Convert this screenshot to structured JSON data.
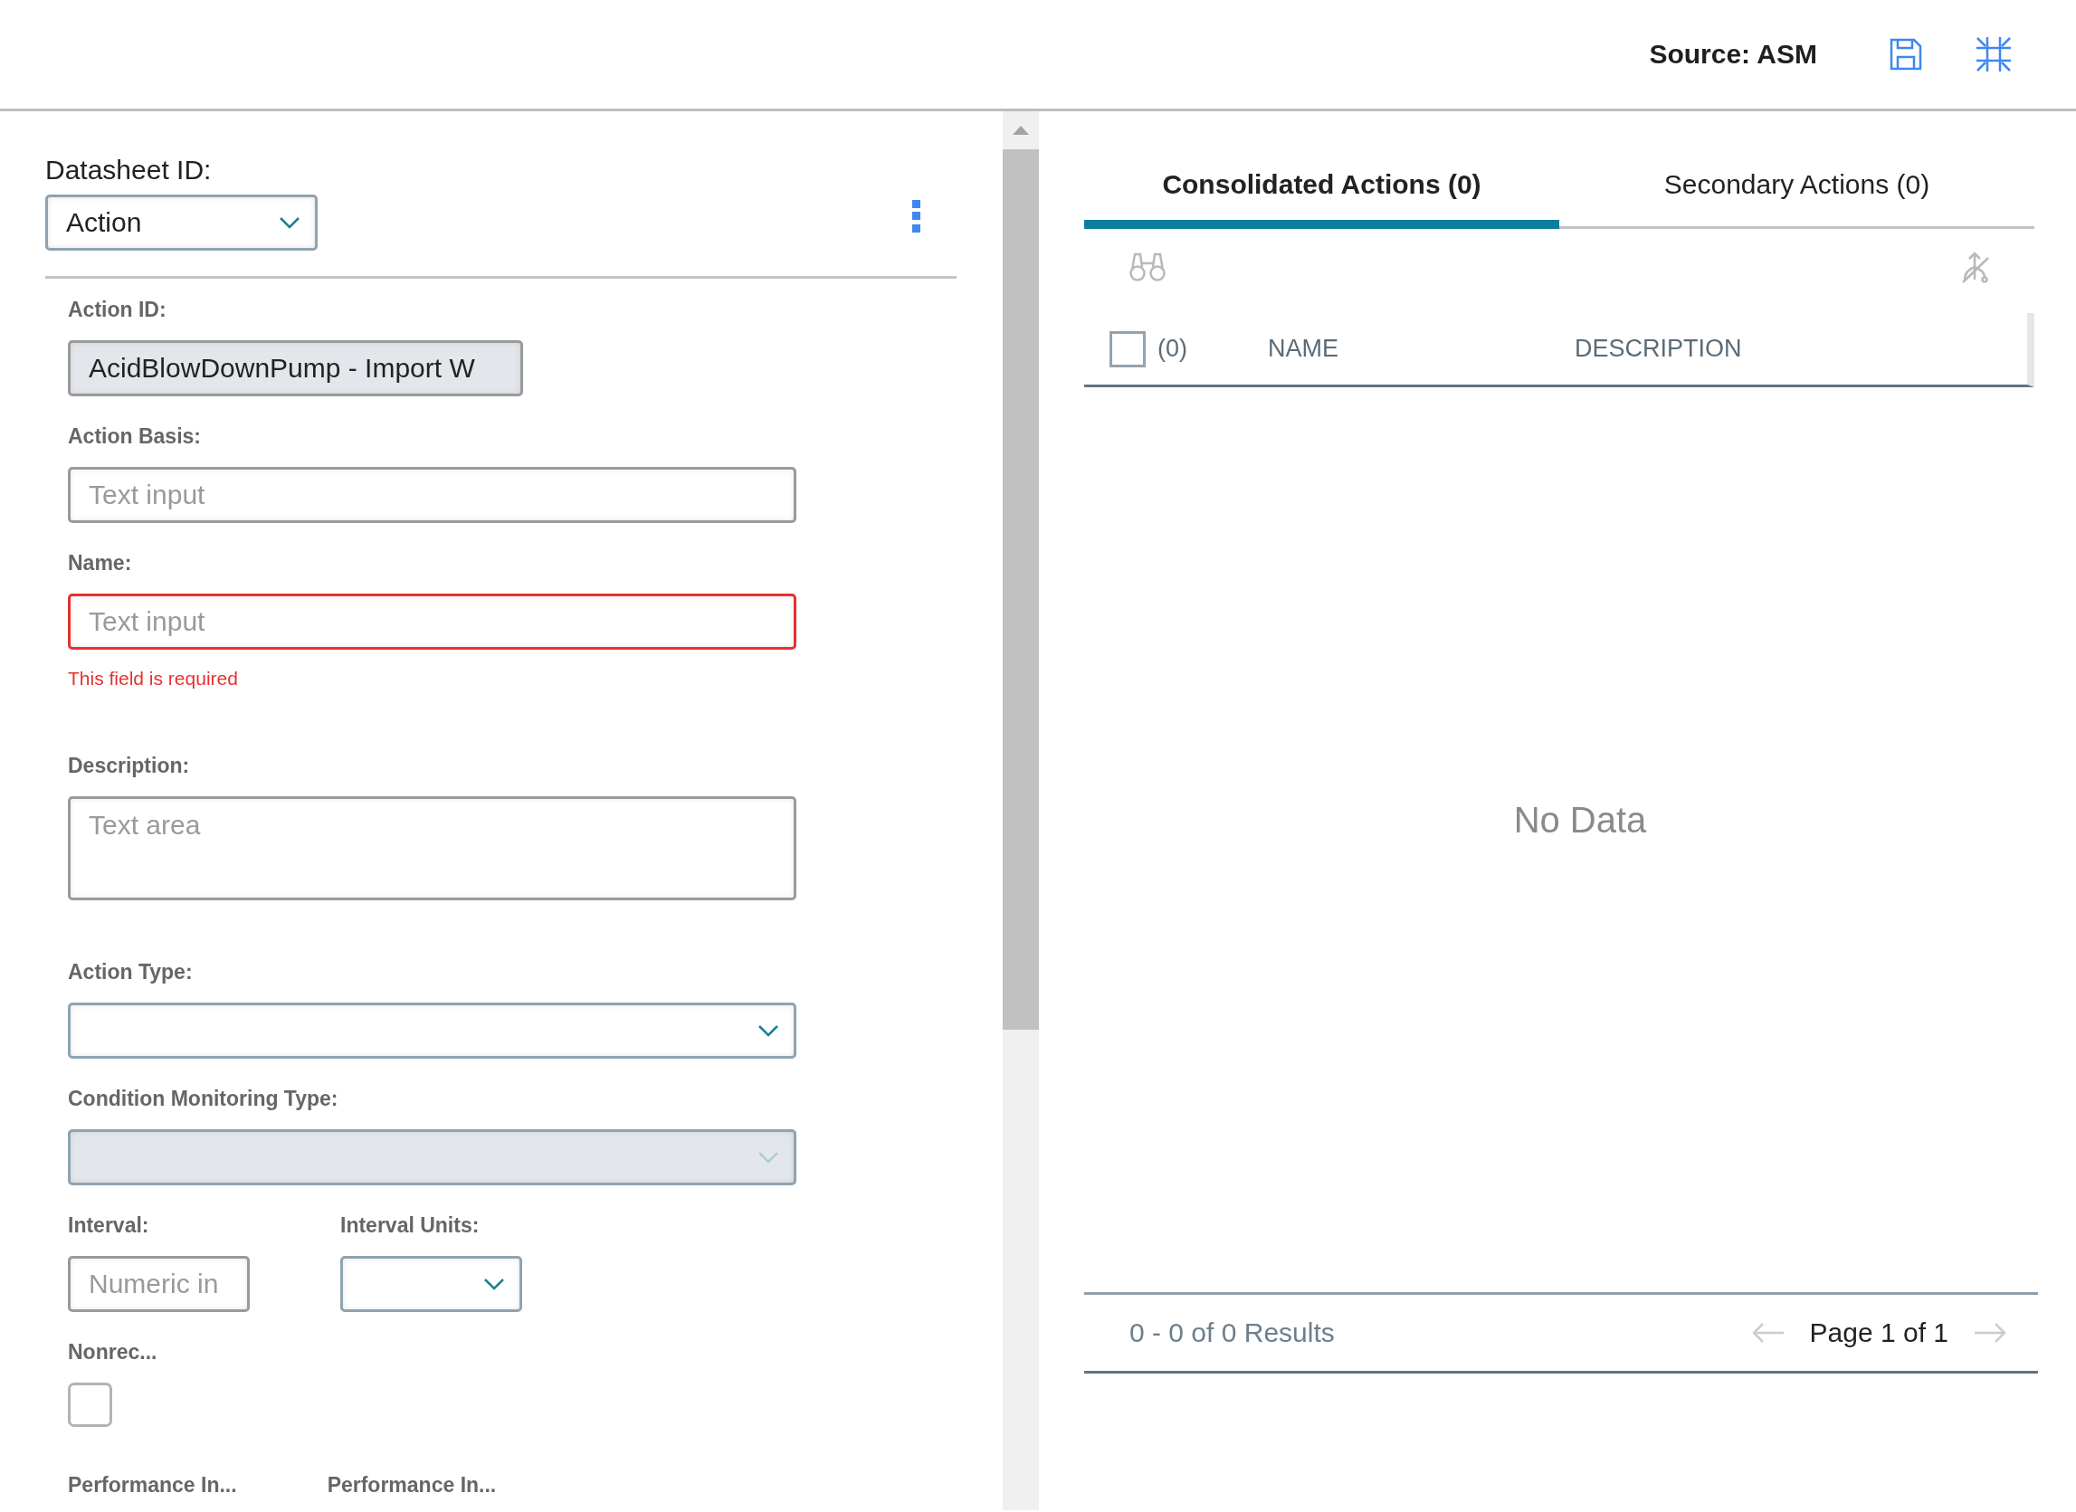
{
  "header": {
    "source": "Source: ASM"
  },
  "datasheet": {
    "label": "Datasheet ID:",
    "value": "Action"
  },
  "rows": [
    [
      {
        "kind": "text",
        "label": "Action ID:",
        "value": "AcidBlowDownPump - Import W",
        "readonly": true,
        "invalid": false
      }
    ],
    [
      {
        "kind": "text",
        "label": "Action Basis:",
        "placeholder": "Text input",
        "readonly": false,
        "invalid": false
      }
    ],
    [
      {
        "kind": "text",
        "label": "Name:",
        "placeholder": "Text input",
        "readonly": false,
        "invalid": true,
        "error": "This field is required"
      }
    ],
    [
      {
        "kind": "textarea",
        "label": "Description:",
        "placeholder": "Text area"
      }
    ],
    [
      {
        "kind": "select",
        "label": "Action Type:",
        "disabled": false
      }
    ],
    [
      {
        "kind": "select",
        "label": "Condition Monitoring Type:",
        "disabled": true
      }
    ],
    [
      {
        "kind": "number",
        "label": "Interval:",
        "placeholder": "Numeric in"
      },
      {
        "kind": "select",
        "label": "Interval Units:",
        "disabled": false
      }
    ],
    [
      {
        "kind": "checkbox",
        "label": "Nonrec...",
        "checked": false
      }
    ],
    [
      {
        "kind": "label",
        "label": "Performance In..."
      },
      {
        "kind": "label",
        "label": "Performance In..."
      }
    ]
  ],
  "tabs": [
    {
      "label": "Consolidated Actions (0)",
      "selected": true
    },
    {
      "label": "Secondary Actions (0)",
      "selected": false
    }
  ],
  "table": {
    "select_all": {
      "checked": false,
      "count": "(0)"
    },
    "columns": [
      "NAME",
      "DESCRIPTION"
    ],
    "empty_text": "No Data"
  },
  "footer": {
    "results": "0 - 0 of 0 Results",
    "page": "Page 1 of 1"
  }
}
